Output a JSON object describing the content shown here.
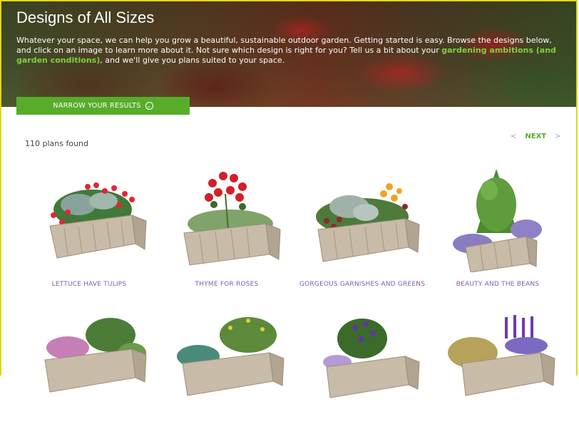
{
  "hero": {
    "title": "Designs of All Sizes",
    "text_before": "Whatever your space, we can help you grow a beautiful, sustainable outdoor garden. Getting started is easy. Browse the designs below, and click on an image to learn more about it. Not sure which design is right for you? Tell us a bit about your ",
    "link_text": "gardening ambitions (and garden conditions)",
    "text_after": ", and we'll give you plans suited to your space."
  },
  "filter_button": {
    "label": "NARROW YOUR RESULTS",
    "icon": "chevron-circle-down-icon"
  },
  "results": {
    "count_text": "110 plans found"
  },
  "pagination": {
    "prev_symbol": "<",
    "next_label": "NEXT",
    "next_symbol": ">"
  },
  "plans": [
    {
      "title": "LETTUCE HAVE TULIPS"
    },
    {
      "title": "THYME FOR ROSES"
    },
    {
      "title": "GORGEOUS GARNISHES AND GREENS"
    },
    {
      "title": "BEAUTY AND THE BEANS"
    },
    {
      "title": ""
    },
    {
      "title": ""
    },
    {
      "title": ""
    },
    {
      "title": ""
    }
  ],
  "colors": {
    "accent_green": "#57ad2a",
    "title_purple": "#8a5aa8",
    "border_yellow": "#e3d51b"
  }
}
